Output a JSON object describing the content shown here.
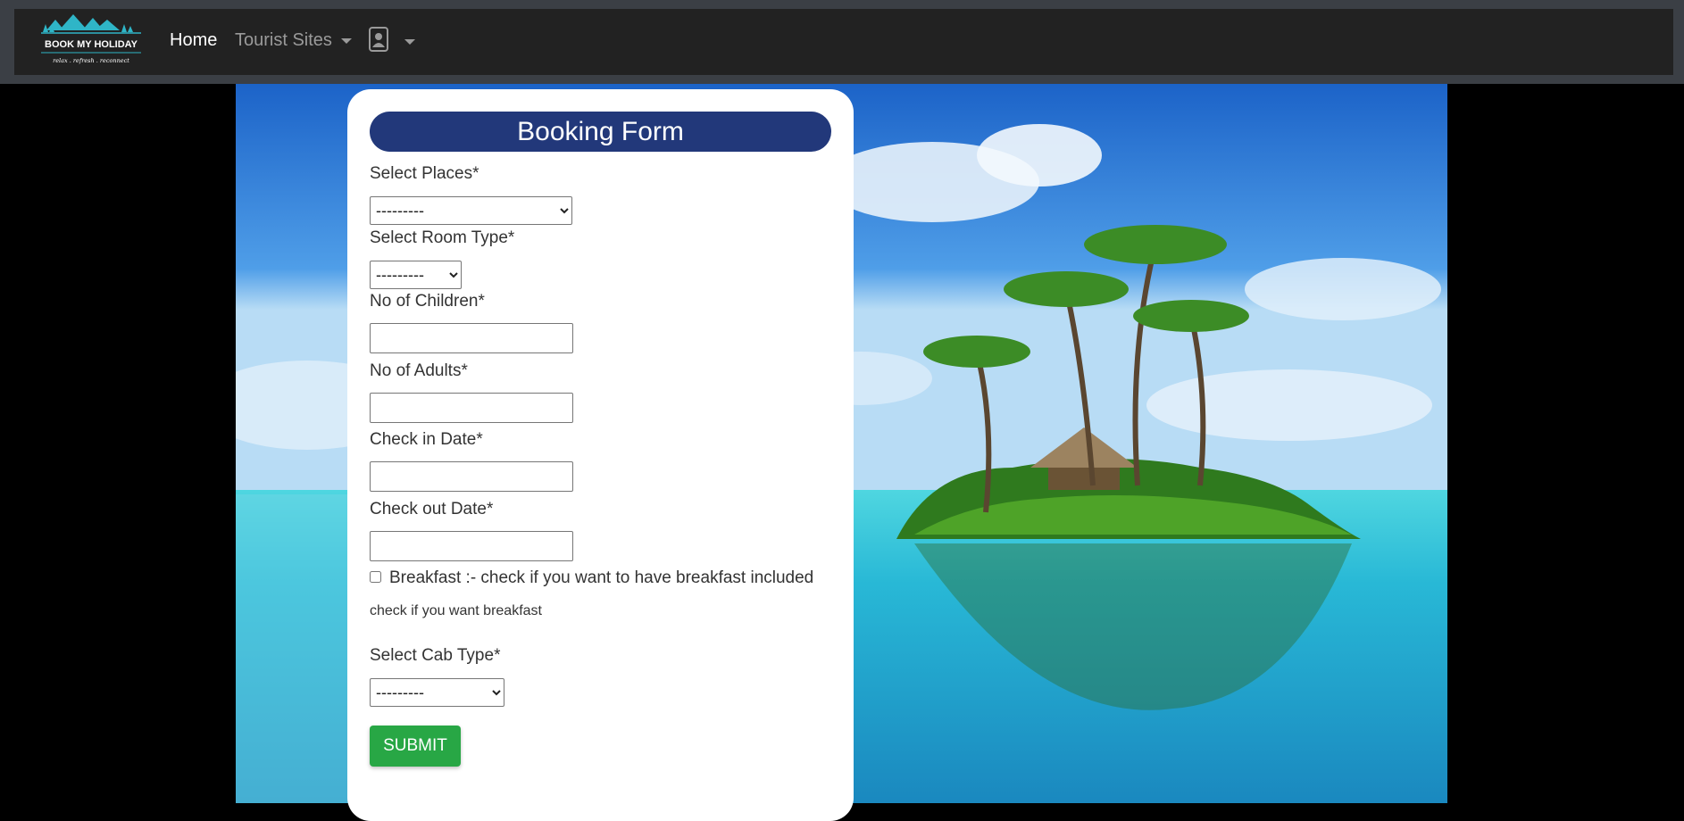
{
  "navbar": {
    "logo": {
      "title": "BOOK MY HOLIDAY",
      "tagline": "relax . refresh . reconnect"
    },
    "home_label": "Home",
    "tourist_sites_label": "Tourist Sites",
    "user_icon": "user-icon"
  },
  "form": {
    "title": "Booking Form",
    "places": {
      "label": "Select Places*",
      "value": "---------"
    },
    "room_type": {
      "label": "Select Room Type*",
      "value": "---------"
    },
    "children": {
      "label": "No of Children*",
      "value": ""
    },
    "adults": {
      "label": "No of Adults*",
      "value": ""
    },
    "check_in": {
      "label": "Check in Date*",
      "value": ""
    },
    "check_out": {
      "label": "Check out Date*",
      "value": ""
    },
    "breakfast": {
      "label": "Breakfast :- check if you want to have breakfast included",
      "help": "check if you want breakfast",
      "checked": false
    },
    "cab_type": {
      "label": "Select Cab Type*",
      "value": "---------"
    },
    "submit_label": "SUBMIT"
  },
  "colors": {
    "navbar_bg": "#222222",
    "topbar_bg": "#3b3f45",
    "title_bg": "#22387a",
    "submit_bg": "#28a745",
    "logo_teal": "#2fb5c7"
  }
}
